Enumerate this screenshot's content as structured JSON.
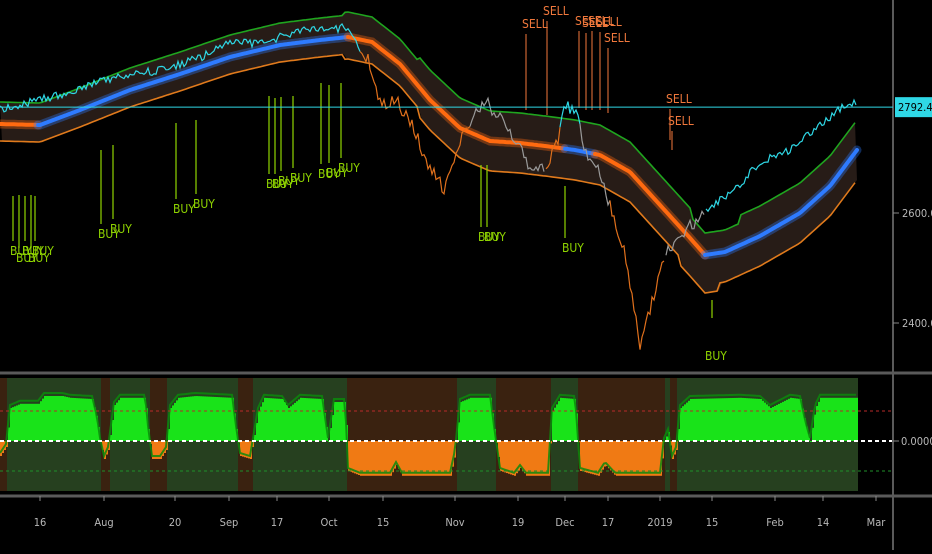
{
  "chart_data": [
    {
      "type": "line",
      "panel": "price",
      "x_labels": [
        "16",
        "Aug",
        "20",
        "Sep",
        "17",
        "Oct",
        "15",
        "Nov",
        "19",
        "Dec",
        "17",
        "2019",
        "15",
        "Feb",
        "14",
        "Mar"
      ],
      "y_ticks": [
        2400.0,
        2600.0
      ],
      "y_tick_labels": [
        "2400.00",
        "2600.00"
      ],
      "ylim": [
        2330,
        2960
      ],
      "last_price": 2792.46,
      "last_price_label": "2792.46",
      "colors": {
        "background": "#000000",
        "price": "#2fd8e6",
        "price_in_band": "#9a9a9a",
        "price_below": "#e0701c",
        "upper_band": "#1fa51f",
        "lower_band": "#e07a1c",
        "midline_up": "#2e7bff",
        "midline_down": "#ff6a10",
        "band_fill": "#2b1f1a",
        "buy_signal": "#8fd400",
        "sell_signal": "#f0783c",
        "last_price_line": "#2fd8e6",
        "axis_text": "#b8b8b8"
      },
      "signals": [
        {
          "label": "BUY",
          "type": "buy",
          "pos": "below"
        },
        {
          "label": "BUY",
          "type": "buy",
          "pos": "below"
        },
        {
          "label": "BUY",
          "type": "buy",
          "pos": "below"
        },
        {
          "label": "BUY",
          "type": "buy",
          "pos": "below"
        },
        {
          "label": "BUY",
          "type": "buy",
          "pos": "below"
        },
        {
          "label": "BUY",
          "type": "buy",
          "pos": "below"
        },
        {
          "label": "BUY",
          "type": "buy",
          "pos": "below"
        },
        {
          "label": "BUY",
          "type": "buy",
          "pos": "below"
        },
        {
          "label": "BUY",
          "type": "buy",
          "pos": "below"
        },
        {
          "label": "BUY",
          "type": "buy",
          "pos": "below"
        },
        {
          "label": "BUY",
          "type": "buy",
          "pos": "below"
        },
        {
          "label": "BUY",
          "type": "buy",
          "pos": "below"
        },
        {
          "label": "BUY",
          "type": "buy",
          "pos": "below"
        },
        {
          "label": "BUY",
          "type": "buy",
          "pos": "below"
        },
        {
          "label": "BUY",
          "type": "buy",
          "pos": "below"
        },
        {
          "label": "BUY",
          "type": "buy",
          "pos": "below"
        },
        {
          "label": "BUY",
          "type": "buy",
          "pos": "below"
        },
        {
          "label": "BUY",
          "type": "buy",
          "pos": "below"
        },
        {
          "label": "BUY",
          "type": "buy",
          "pos": "below"
        },
        {
          "label": "SELL",
          "type": "sell",
          "pos": "above"
        },
        {
          "label": "SELL",
          "type": "sell",
          "pos": "above"
        },
        {
          "label": "SELL",
          "type": "sell",
          "pos": "above"
        },
        {
          "label": "SELL",
          "type": "sell",
          "pos": "above"
        },
        {
          "label": "SELL",
          "type": "sell",
          "pos": "above"
        },
        {
          "label": "SELL",
          "type": "sell",
          "pos": "above"
        },
        {
          "label": "SELL",
          "type": "sell",
          "pos": "above"
        },
        {
          "label": "SELL",
          "type": "sell",
          "pos": "above"
        },
        {
          "label": "SELL",
          "type": "sell",
          "pos": "above"
        }
      ]
    },
    {
      "type": "area",
      "panel": "oscillator",
      "y_ticks": [
        0.0
      ],
      "y_tick_labels": [
        "0.0000"
      ],
      "ylim": [
        -1.15,
        1.15
      ],
      "levels": [
        0.5,
        0.0,
        -0.5
      ],
      "colors": {
        "positive": "#19e319",
        "positive_edge": "#10b010",
        "negative": "#f07a14",
        "negative_edge": "#c35a0a",
        "bg_positive": "#26401f",
        "bg_negative": "#3a2210",
        "zero_line": "#ffffff",
        "upper_level": "#b82a2a",
        "lower_level": "#1f8f2a"
      }
    }
  ]
}
